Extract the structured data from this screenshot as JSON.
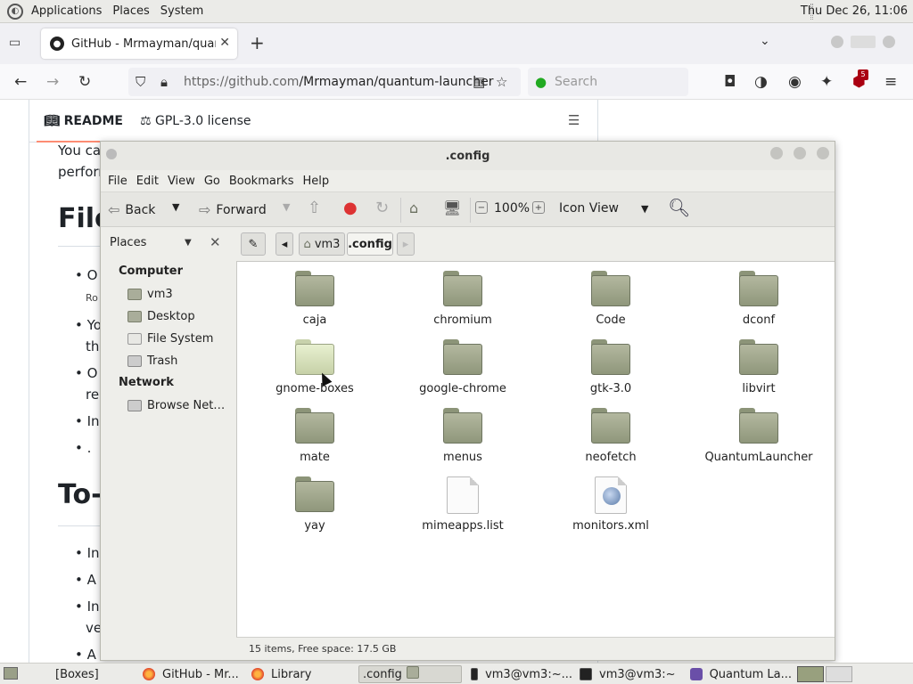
{
  "top_panel": {
    "menus": [
      "Applications",
      "Places",
      "System"
    ],
    "clock": "Thu Dec 26, 11:06"
  },
  "firefox": {
    "tab_title": "GitHub - Mrmayman/quantum-launcher",
    "url_host": "https://github.com",
    "url_path": "/Mrmayman/quantum-launcher",
    "search_placeholder": "Search",
    "extension_badge": "5"
  },
  "github": {
    "readme_tab": "README",
    "license_tab": "GPL-3.0 license",
    "line1": "You ca",
    "line2": "perforn",
    "heading1": "File",
    "heading2": "To-",
    "bullets1": [
      "O",
      "Yo",
      "th",
      "O",
      "re",
      "In",
      "."
    ],
    "small1": "Ro",
    "bullets2": [
      "In",
      "A",
      "In",
      "ve",
      "A"
    ]
  },
  "caja": {
    "window_title": ".config",
    "menu": [
      "File",
      "Edit",
      "View",
      "Go",
      "Bookmarks",
      "Help"
    ],
    "toolbar": {
      "back": "Back",
      "forward": "Forward",
      "zoom": "100%",
      "view_mode": "Icon View"
    },
    "sidebar_label": "Places",
    "breadcrumb": [
      "vm3",
      ".config"
    ],
    "sidebar": {
      "computer_header": "Computer",
      "computer_items": [
        "vm3",
        "Desktop",
        "File System",
        "Trash"
      ],
      "network_header": "Network",
      "network_items": [
        "Browse Net…"
      ]
    },
    "files": [
      {
        "name": "caja",
        "type": "folder"
      },
      {
        "name": "chromium",
        "type": "folder"
      },
      {
        "name": "Code",
        "type": "folder"
      },
      {
        "name": "dconf",
        "type": "folder"
      },
      {
        "name": "gnome-boxes",
        "type": "folder-hover"
      },
      {
        "name": "google-chrome",
        "type": "folder"
      },
      {
        "name": "gtk-3.0",
        "type": "folder"
      },
      {
        "name": "libvirt",
        "type": "folder"
      },
      {
        "name": "mate",
        "type": "folder"
      },
      {
        "name": "menus",
        "type": "folder"
      },
      {
        "name": "neofetch",
        "type": "folder"
      },
      {
        "name": "QuantumLauncher",
        "type": "folder"
      },
      {
        "name": "yay",
        "type": "folder"
      },
      {
        "name": "mimeapps.list",
        "type": "text-file"
      },
      {
        "name": "monitors.xml",
        "type": "xml-file"
      }
    ],
    "status": "15 items, Free space: 17.5 GB"
  },
  "taskbar": {
    "tasks": [
      {
        "label": "[Boxes]",
        "icon": "none"
      },
      {
        "label": "GitHub - Mr...",
        "icon": "firefox"
      },
      {
        "label": "Library",
        "icon": "firefox"
      },
      {
        "label": ".config",
        "icon": "folder"
      },
      {
        "label": "vm3@vm3:~...",
        "icon": "terminal"
      },
      {
        "label": "vm3@vm3:~",
        "icon": "terminal"
      },
      {
        "label": "Quantum La...",
        "icon": "quantum"
      }
    ]
  }
}
